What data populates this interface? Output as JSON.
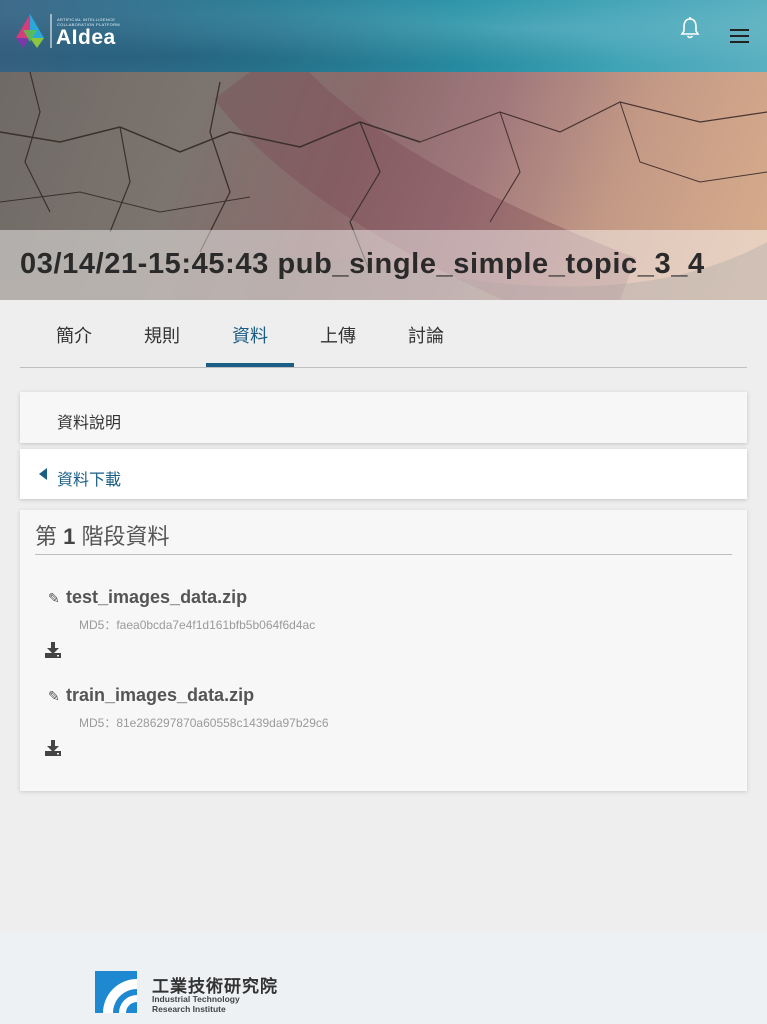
{
  "header": {
    "logo_subtitle": "ARTIFICIAL INTELLIGENCE COLLABORATION PLATFORM",
    "logo_text": "AIdea",
    "icons": [
      "bell-icon",
      "menu-icon"
    ]
  },
  "banner": {
    "title": "03/14/21-15:45:43 pub_single_simple_topic_3_4"
  },
  "tabs": [
    {
      "label": "簡介",
      "active": false
    },
    {
      "label": "規則",
      "active": false
    },
    {
      "label": "資料",
      "active": true
    },
    {
      "label": "上傳",
      "active": false
    },
    {
      "label": "討論",
      "active": false
    }
  ],
  "sections": {
    "data_description": "資料說明",
    "data_download": "資料下載"
  },
  "stage": {
    "prefix": "第",
    "number": "1",
    "suffix": "階段資料",
    "files": [
      {
        "name": "test_images_data.zip",
        "md5": "MD5：faea0bcda7e4f1d161bfb5b064f6d4ac"
      },
      {
        "name": "train_images_data.zip",
        "md5": "MD5：81e286297870a60558c1439da97b29c6"
      }
    ]
  },
  "footer": {
    "org_cn": "工業技術研究院",
    "org_en_line1": "Industrial Technology",
    "org_en_line2": "Research Institute"
  },
  "colors": {
    "accent": "#1a5e86",
    "header_gradient": "#2e7f98"
  }
}
